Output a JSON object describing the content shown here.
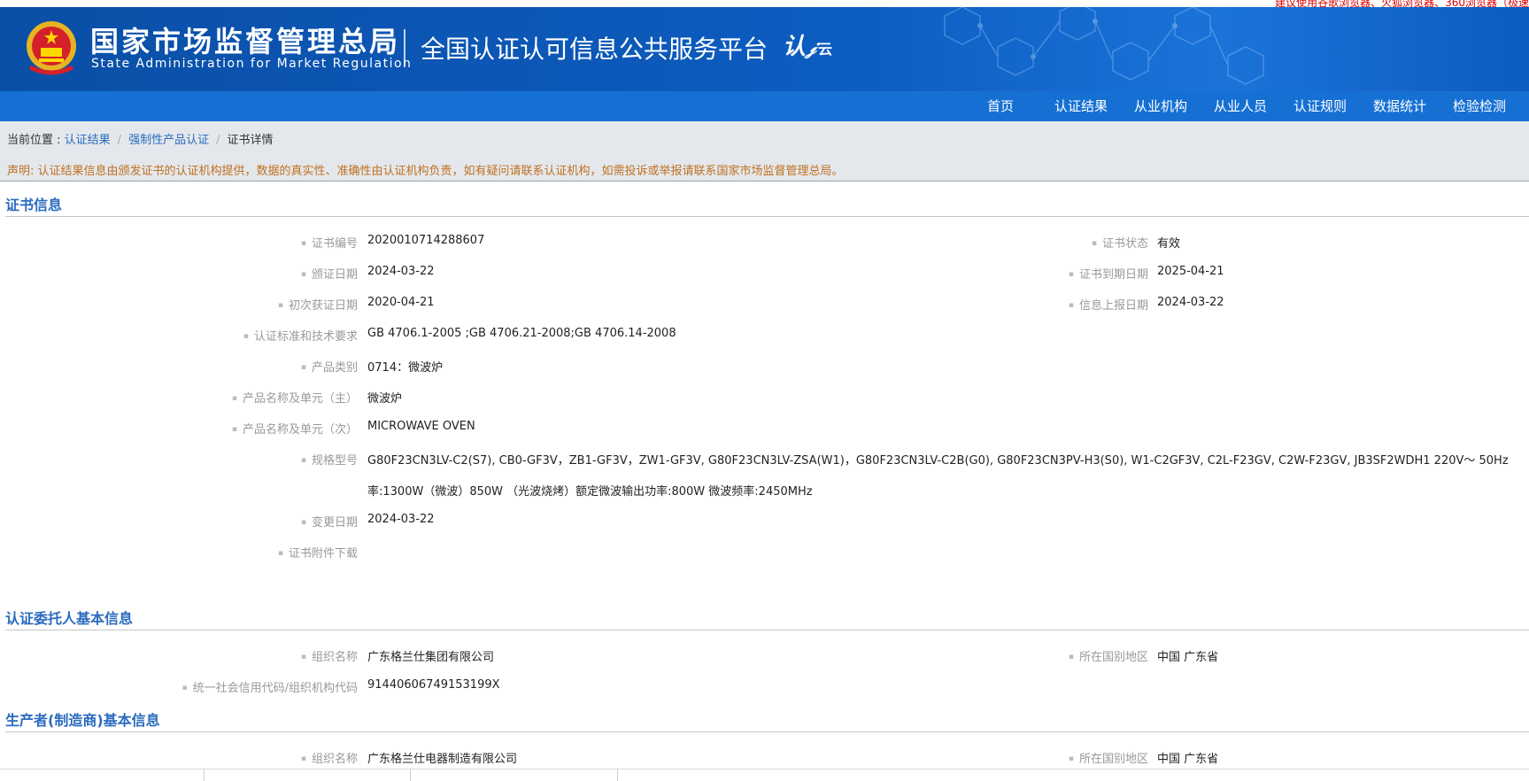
{
  "top_notice": "建议使用谷歌浏览器、火狐浏览器、360浏览器（极速",
  "header": {
    "org_cn": "国家市场监督管理总局",
    "org_en": "State Administration for Market Regulation",
    "platform": "全国认证认可信息公共服务平台",
    "brand_main": "认",
    "brand_sub": "云"
  },
  "nav": [
    "首页",
    "认证结果",
    "从业机构",
    "从业人员",
    "认证规则",
    "数据统计",
    "检验检测"
  ],
  "breadcrumb": {
    "prefix": "当前位置 : ",
    "items": [
      "认证结果",
      "强制性产品认证",
      "证书详情"
    ]
  },
  "disclaimer": "声明: 认证结果信息由颁发证书的认证机构提供，数据的真实性、准确性由认证机构负责，如有疑问请联系认证机构，如需投诉或举报请联系国家市场监督管理总局。",
  "cert_section": {
    "title": "证书信息",
    "left": [
      {
        "label": "证书编号",
        "value": "2020010714288607"
      },
      {
        "label": "颁证日期",
        "value": "2024-03-22"
      },
      {
        "label": "初次获证日期",
        "value": "2020-04-21"
      },
      {
        "label": "认证标准和技术要求",
        "value": "GB 4706.1-2005 ;GB 4706.21-2008;GB 4706.14-2008"
      },
      {
        "label": "产品类别",
        "value": "0714：微波炉"
      },
      {
        "label": "产品名称及单元（主）",
        "value": "微波炉"
      },
      {
        "label": "产品名称及单元（次）",
        "value": "MICROWAVE OVEN"
      },
      {
        "label": "规格型号",
        "value": "G80F23CN3LV-C2(S7), CB0-GF3V，ZB1-GF3V，ZW1-GF3V, G80F23CN3LV-ZSA(W1)，G80F23CN3LV-C2B(G0), G80F23CN3PV-H3(S0), W1-C2GF3V, C2L-F23GV, C2W-F23GV, JB3SF2WDH1 220V～ 50Hz"
      },
      {
        "label": "变更日期",
        "value": "2024-03-22"
      },
      {
        "label": "证书附件下载",
        "value": ""
      }
    ],
    "model_line2": "率:1300W（微波）850W （光波烧烤）额定微波输出功率:800W 微波频率:2450MHz",
    "right": [
      {
        "label": "证书状态",
        "value": "有效"
      },
      {
        "label": "证书到期日期",
        "value": "2025-04-21"
      },
      {
        "label": "信息上报日期",
        "value": "2024-03-22"
      }
    ]
  },
  "client_section": {
    "title": "认证委托人基本信息",
    "left": [
      {
        "label": "组织名称",
        "value": "广东格兰仕集团有限公司"
      },
      {
        "label": "统一社会信用代码/组织机构代码",
        "value": "91440606749153199X"
      }
    ],
    "right": [
      {
        "label": "所在国别地区",
        "value": "中国 广东省"
      }
    ]
  },
  "maker_section": {
    "title": "生产者(制造商)基本信息",
    "left": [
      {
        "label": "组织名称",
        "value": "广东格兰仕电器制造有限公司"
      }
    ],
    "right": [
      {
        "label": "所在国别地区",
        "value": "中国 广东省"
      }
    ]
  },
  "colors": {
    "header": "#0a4fa6",
    "nav": "#1670d4",
    "link": "#2a6bbf",
    "notice": "#c07020"
  }
}
